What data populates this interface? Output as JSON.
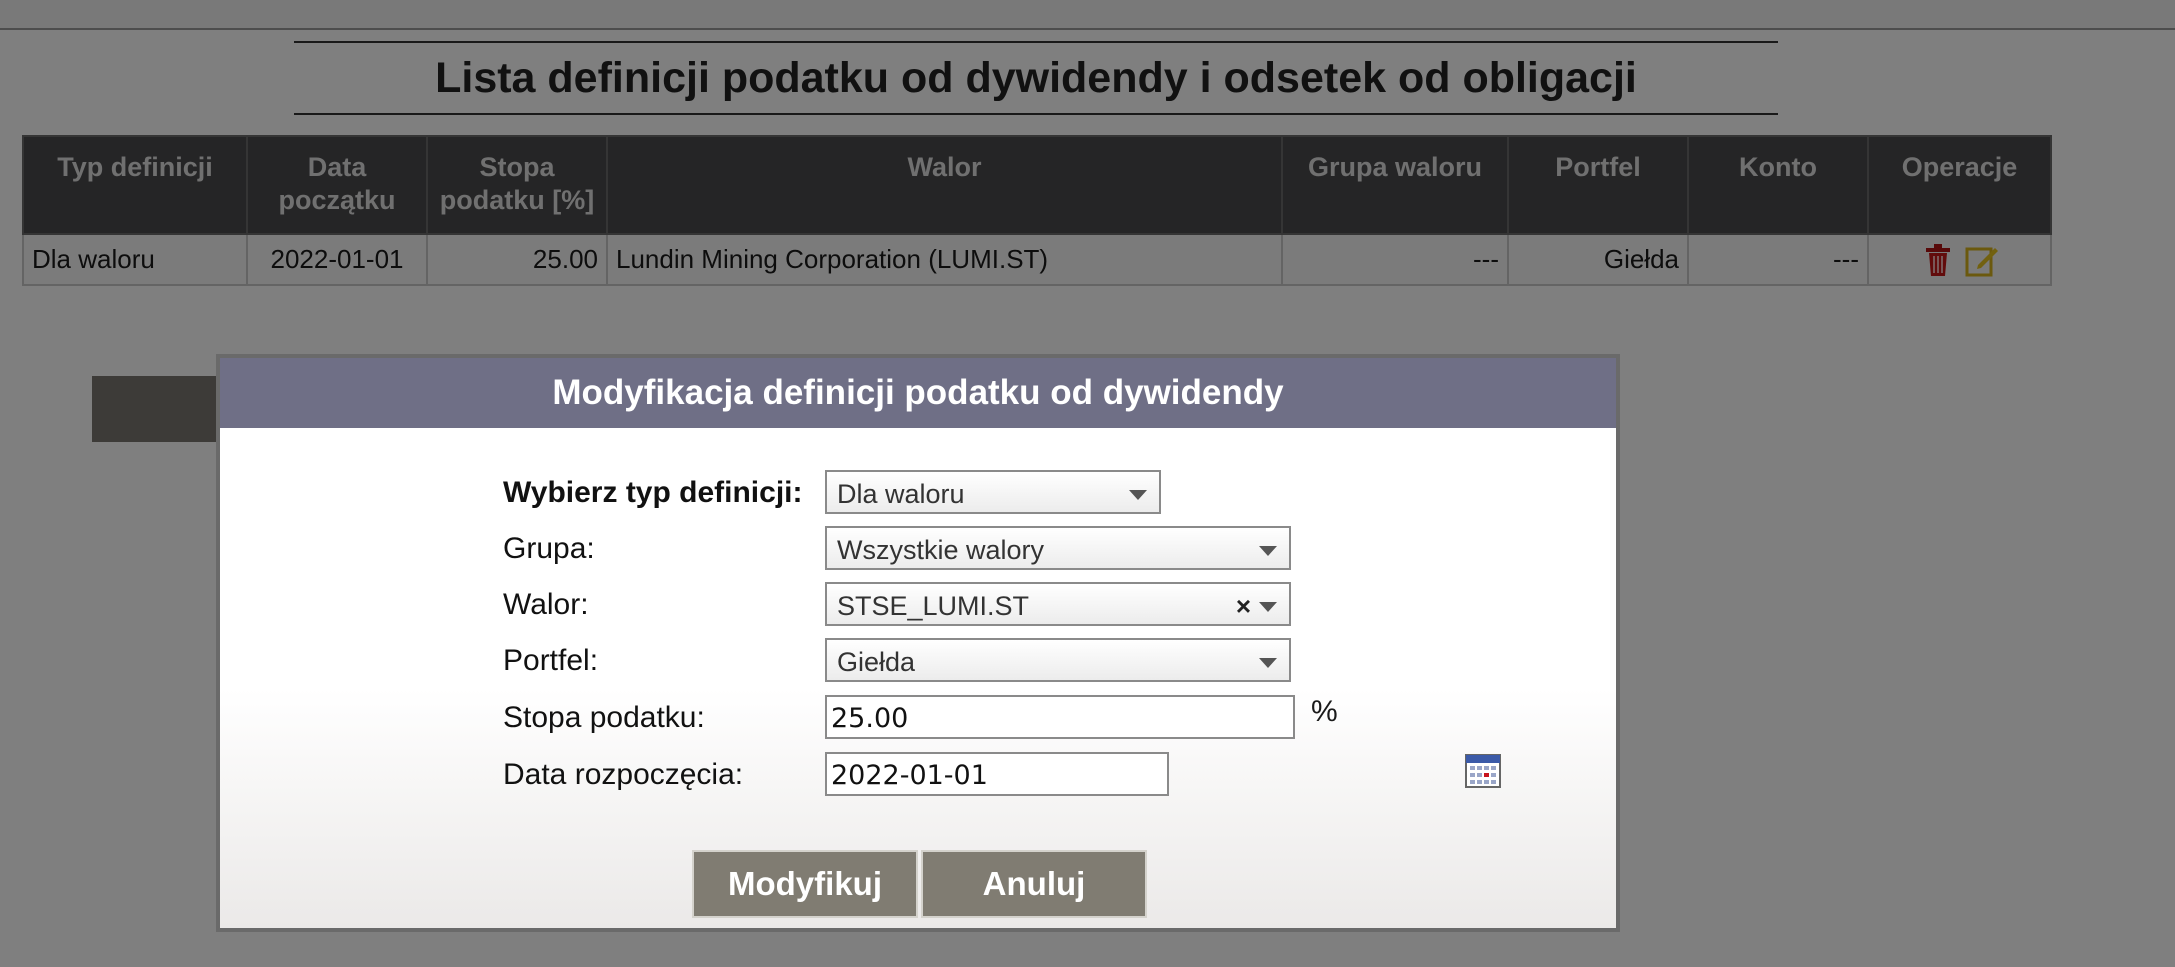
{
  "page": {
    "title": "Lista definicji podatku od dywidendy i odsetek od obligacji"
  },
  "table": {
    "headers": [
      "Typ definicji",
      "Data początku",
      "Stopa podatku [%]",
      "Walor",
      "Grupa waloru",
      "Portfel",
      "Konto",
      "Operacje"
    ],
    "rows": [
      {
        "typ": "Dla waloru",
        "data": "2022-01-01",
        "stopa": "25.00",
        "walor": "Lundin Mining Corporation (LUMI.ST)",
        "grupa": "---",
        "portfel": "Giełda",
        "konto": "---"
      }
    ],
    "operations": {
      "delete_icon": "trash-icon",
      "edit_icon": "edit-icon"
    }
  },
  "dialog": {
    "title": "Modyfikacja definicji podatku od dywidendy",
    "fields": {
      "typ": {
        "label": "Wybierz typ definicji:",
        "value": "Dla waloru"
      },
      "grupa": {
        "label": "Grupa:",
        "value": "Wszystkie walory"
      },
      "walor": {
        "label": "Walor:",
        "value": "STSE_LUMI.ST",
        "clear": "×"
      },
      "portfel": {
        "label": "Portfel:",
        "value": "Giełda"
      },
      "stopa": {
        "label": "Stopa podatku:",
        "value": "25.00",
        "unit": "%"
      },
      "data": {
        "label": "Data rozpoczęcia:",
        "value": "2022-01-01"
      }
    },
    "buttons": {
      "modify": "Modyfikuj",
      "cancel": "Anuluj"
    }
  },
  "colors": {
    "header_bg": "#4a4a4c",
    "dialog_header_bg": "#6f6f86",
    "button_bg": "#807c72"
  }
}
